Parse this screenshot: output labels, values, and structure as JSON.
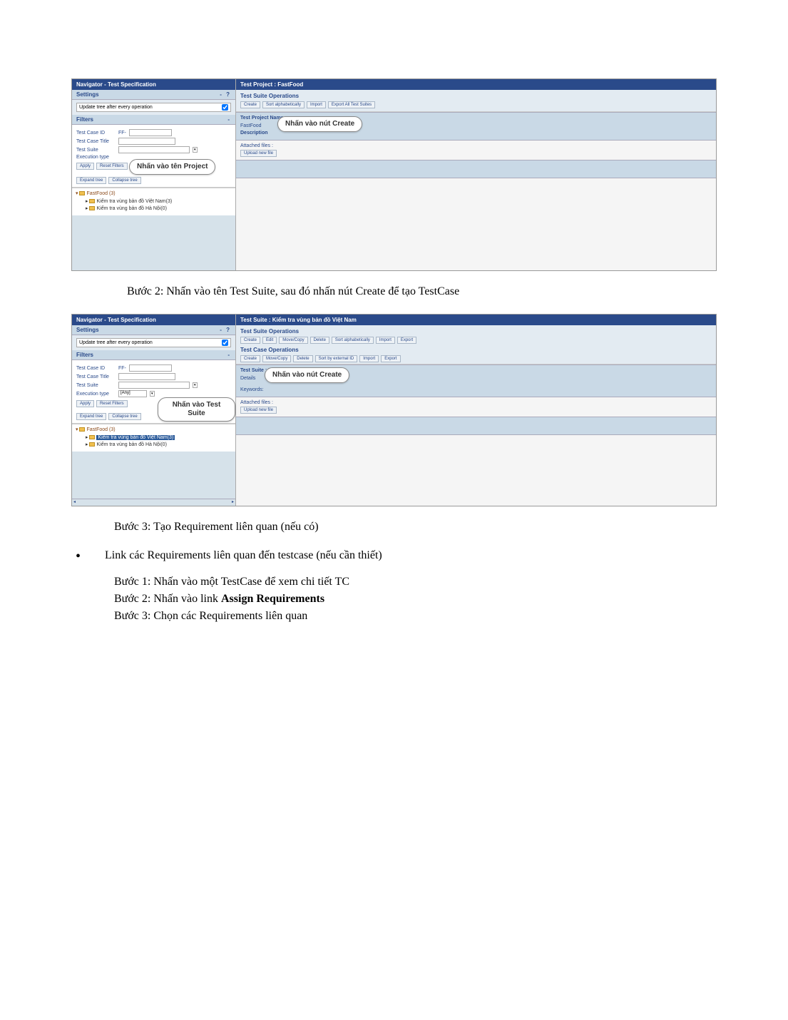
{
  "shot1": {
    "nav_title": "Navigator - Test Specification",
    "settings_hdr": "Settings",
    "settings_text": "Update tree after every operation",
    "filters_hdr": "Filters",
    "f_tcid": "Test Case ID",
    "f_tcid_prefix": "FF-",
    "f_tctitle": "Test Case Title",
    "f_tsuite": "Test Suite",
    "f_exec": "Execution type",
    "btn_apply": "Apply",
    "btn_reset": "Reset Filters",
    "btn_expand": "Expand tree",
    "btn_collapse": "Collapse tree",
    "callout_left": "Nhấn vào tên Project",
    "tree_root": "FastFood (3)",
    "tree_i1": "Kiểm tra vùng bản đồ Việt Nam(3)",
    "tree_i2": "Kiểm tra vùng bản đồ Hà Nội(0)",
    "right_title": "Test Project : FastFood",
    "ops_title": "Test Suite Operations",
    "b_create": "Create",
    "b_sort": "Sort alphabetically",
    "b_import": "Import",
    "b_export": "Export All Test Suites",
    "info_tp": "Test Project Name",
    "info_name": "FastFood",
    "info_desc": "Description",
    "callout_right": "Nhấn vào nút Create",
    "attached": "Attached files :",
    "b_upload": "Upload new file"
  },
  "shot2": {
    "nav_title": "Navigator - Test Specification",
    "settings_hdr": "Settings",
    "settings_text": "Update tree after every operation",
    "filters_hdr": "Filters",
    "f_tcid": "Test Case ID",
    "f_tcid_prefix": "FF-",
    "f_tctitle": "Test Case Title",
    "f_tsuite": "Test Suite",
    "f_exec": "Execution type",
    "exec_any": "[Any]",
    "btn_apply": "Apply",
    "btn_reset": "Reset Filters",
    "btn_expand": "Expand tree",
    "btn_collapse": "Collapse tree",
    "callout_left": "Nhấn vào Test Suite",
    "tree_root": "FastFood (3)",
    "tree_i1": "Kiểm tra vùng bản đồ Việt Nam(3)",
    "tree_i2": "Kiểm tra vùng bản đồ Hà Nội(0)",
    "right_title": "Test Suite : Kiểm tra vùng bản đồ Việt Nam",
    "ts_ops_title": "Test Suite Operations",
    "ts_b_create": "Create",
    "ts_b_edit": "Edit",
    "ts_b_move": "Move/Copy",
    "ts_b_delete": "Delete",
    "ts_b_sort": "Sort alphabetically",
    "ts_b_import": "Import",
    "ts_b_export": "Export",
    "tc_ops_title": "Test Case Operations",
    "tc_b_create": "Create",
    "tc_b_move": "Move/Copy",
    "tc_b_delete": "Delete",
    "tc_b_sortext": "Sort by external ID",
    "tc_b_import": "Import",
    "tc_b_export": "Export",
    "info_ts": "Test Suite : Kiểm tra vùng bản đồ Việt Nam",
    "info_detail": "Details",
    "info_kw": "Keywords:",
    "callout_right": "Nhấn vào nút Create",
    "attached": "Attached files :",
    "b_upload": "Upload new file"
  },
  "captions": {
    "c2": "Bước 2: Nhấn vào tên Test Suite, sau đó nhấn nút Create để tạo TestCase",
    "c3": "Bước 3: Tạo Requirement liên quan (nếu có)",
    "bullet": "Link các Requirements liên quan đến testcase (nếu cần thiết)",
    "s1": "Bước 1: Nhấn vào một TestCase để xem chi tiết TC",
    "s2a": "Bước 2: Nhấn vào link ",
    "s2b": "Assign Requirements",
    "s3": "Bước 3: Chọn các Requirements liên quan"
  }
}
